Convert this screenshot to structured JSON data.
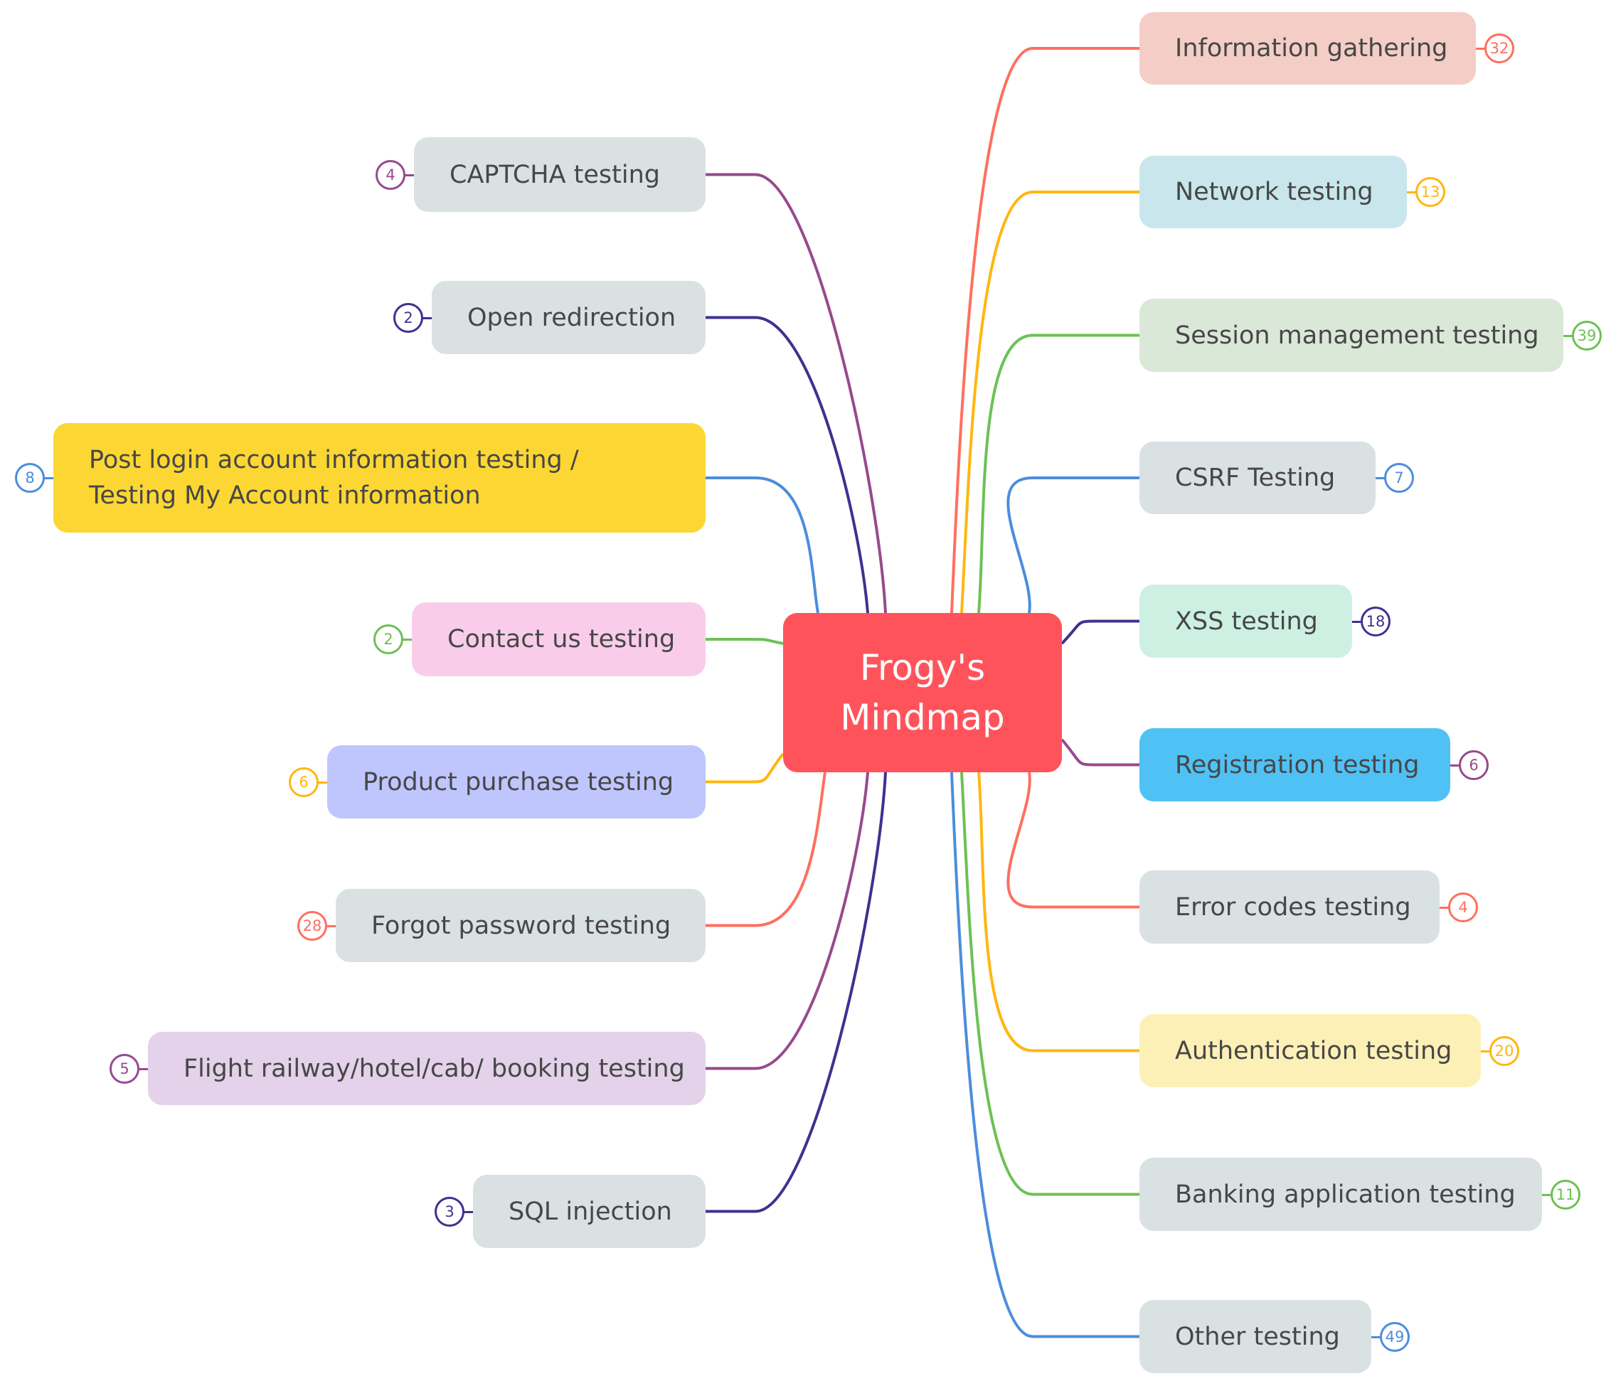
{
  "root": {
    "label": "Frogy's Mindmap",
    "color": "#ff535c"
  },
  "branches": [
    {
      "side": "right",
      "label": "Information gathering",
      "count": "32",
      "line_color": "#ff6f5e",
      "fill": "#f4cdc7"
    },
    {
      "side": "right",
      "label": "Network testing",
      "count": "13",
      "line_color": "#ffb60f",
      "fill": "#c8e6ec"
    },
    {
      "side": "right",
      "label": "Session management testing",
      "count": "39",
      "line_color": "#6cc154",
      "fill": "#dae8d8"
    },
    {
      "side": "right",
      "label": "CSRF Testing",
      "count": "7",
      "line_color": "#4c8ddc",
      "fill": "#dae1e3"
    },
    {
      "side": "right",
      "label": "XSS testing",
      "count": "18",
      "line_color": "#3d3290",
      "fill": "#cdf0e3"
    },
    {
      "side": "right",
      "label": "Registration testing",
      "count": "6",
      "line_color": "#974a8d",
      "fill": "#4fc1f5"
    },
    {
      "side": "right",
      "label": "Error codes testing",
      "count": "4",
      "line_color": "#ff6f5e",
      "fill": "#dae1e3"
    },
    {
      "side": "right",
      "label": "Authentication testing",
      "count": "20",
      "line_color": "#ffb60f",
      "fill": "#fdf0b7"
    },
    {
      "side": "right",
      "label": "Banking application testing",
      "count": "11",
      "line_color": "#6cc154",
      "fill": "#dae1e3"
    },
    {
      "side": "right",
      "label": "Other testing",
      "count": "49",
      "line_color": "#4c8ddc",
      "fill": "#dae1e3"
    },
    {
      "side": "left",
      "label": "CAPTCHA testing",
      "count": "4",
      "line_color": "#974a8d",
      "fill": "#dae1e3"
    },
    {
      "side": "left",
      "label": "Open redirection",
      "count": "2",
      "line_color": "#3d3290",
      "fill": "#dae1e3"
    },
    {
      "side": "left",
      "label": "Post login account information testing / Testing My Account information",
      "count": "8",
      "line_color": "#4c8ddc",
      "fill": "#fcd733"
    },
    {
      "side": "left",
      "label": "Contact us testing",
      "count": "2",
      "line_color": "#6cc154",
      "fill": "#f9cdea"
    },
    {
      "side": "left",
      "label": "Product purchase testing",
      "count": "6",
      "line_color": "#ffb60f",
      "fill": "#bec6fd"
    },
    {
      "side": "left",
      "label": "Forgot password testing",
      "count": "28",
      "line_color": "#ff6f5e",
      "fill": "#dae1e3"
    },
    {
      "side": "left",
      "label": "Flight railway/hotel/cab/ booking testing",
      "count": "5",
      "line_color": "#974a8d",
      "fill": "#e3d2ea"
    },
    {
      "side": "left",
      "label": "SQL injection",
      "count": "3",
      "line_color": "#3d3290",
      "fill": "#dae1e3"
    }
  ]
}
